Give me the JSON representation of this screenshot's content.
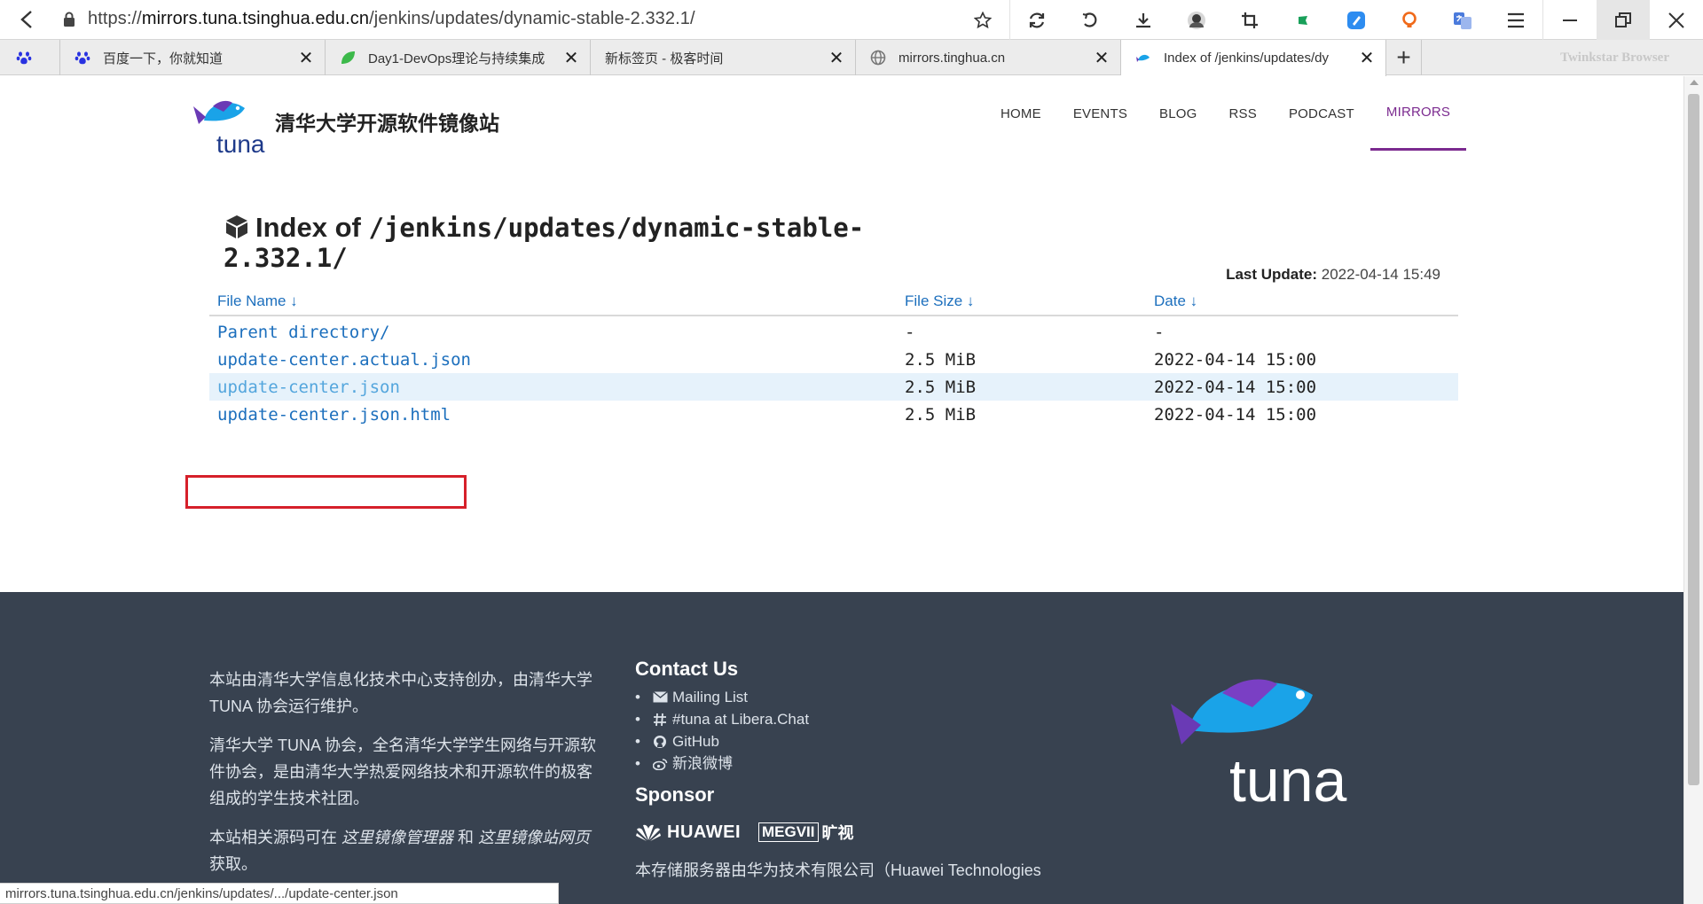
{
  "browser": {
    "url_prefix": "https://",
    "url_host": "mirrors.tuna.tsinghua.edu.cn",
    "url_path": "/jenkins/updates/dynamic-stable-2.332.1/",
    "brand": "Twinkstar Browser",
    "tabs": [
      {
        "title": "",
        "icon": "baidu-paw-icon"
      },
      {
        "title": "百度一下，你就知道",
        "icon": "baidu-paw-icon"
      },
      {
        "title": "Day1-DevOps理论与持续集成",
        "icon": "leaf-icon"
      },
      {
        "title": "新标签页 - 极客时间",
        "icon": "none"
      },
      {
        "title": "mirrors.tinghua.cn",
        "icon": "globe-icon"
      },
      {
        "title": "Index of /jenkins/updates/dy",
        "icon": "tuna-fish-icon"
      }
    ],
    "new_tab_label": "+",
    "close_glyph": "✕",
    "status_text": "mirrors.tuna.tsinghua.edu.cn/jenkins/updates/.../update-center.json"
  },
  "site": {
    "name": "清华大学开源软件镜像站",
    "nav": [
      "HOME",
      "EVENTS",
      "BLOG",
      "RSS",
      "PODCAST",
      "MIRRORS"
    ],
    "nav_active": "MIRRORS"
  },
  "index": {
    "title_prefix": "Index of",
    "title_path": "/jenkins/updates/dynamic-stable-2.332.1/",
    "last_update_label": "Last Update:",
    "last_update_value": "2022-04-14 15:49",
    "columns": [
      "File Name ↓",
      "File Size ↓",
      "Date ↓"
    ],
    "rows": [
      {
        "name": "Parent directory/",
        "size": "-",
        "date": "-"
      },
      {
        "name": "update-center.actual.json",
        "size": "2.5 MiB",
        "date": "2022-04-14 15:00"
      },
      {
        "name": "update-center.json",
        "size": "2.5 MiB",
        "date": "2022-04-14 15:00"
      },
      {
        "name": "update-center.json.html",
        "size": "2.5 MiB",
        "date": "2022-04-14 15:00"
      }
    ],
    "highlighted_row": 2
  },
  "footer": {
    "about_1": "本站由清华大学信息化技术中心支持创办，由清华大学 TUNA 协会运行维护。",
    "about_2": "清华大学 TUNA 协会，全名清华大学学生网络与开源软件协会，是由清华大学热爱网络技术和开源软件的极客组成的学生技术社团。",
    "about_3_a": "本站相关源码可在 ",
    "about_3_link1": "这里镜像管理器",
    "about_3_b": " 和 ",
    "about_3_link2": "这里镜像站网页",
    "about_3_c": " 获取。",
    "contact_title": "Contact Us",
    "contacts": [
      {
        "label": "Mailing List",
        "icon": "envelope-icon"
      },
      {
        "label": "#tuna at Libera.Chat",
        "icon": "hash-icon"
      },
      {
        "label": "GitHub",
        "icon": "github-icon"
      },
      {
        "label": "新浪微博",
        "icon": "weibo-icon"
      }
    ],
    "bullet": "•",
    "sponsor_title": "Sponsor",
    "sponsor_huawei": "HUAWEI",
    "sponsor_megvii_box": "MEGVII",
    "sponsor_megvii_cn": "旷视",
    "sponsor_text": "本存储服务器由华为技术有限公司（Huawei Technologies"
  },
  "colors": {
    "link": "#1c6fbd",
    "nav_active": "#7b2a8f",
    "footer_bg": "#384250",
    "highlight_row": "#e6f2fb",
    "annotation_red": "#d6202a"
  }
}
